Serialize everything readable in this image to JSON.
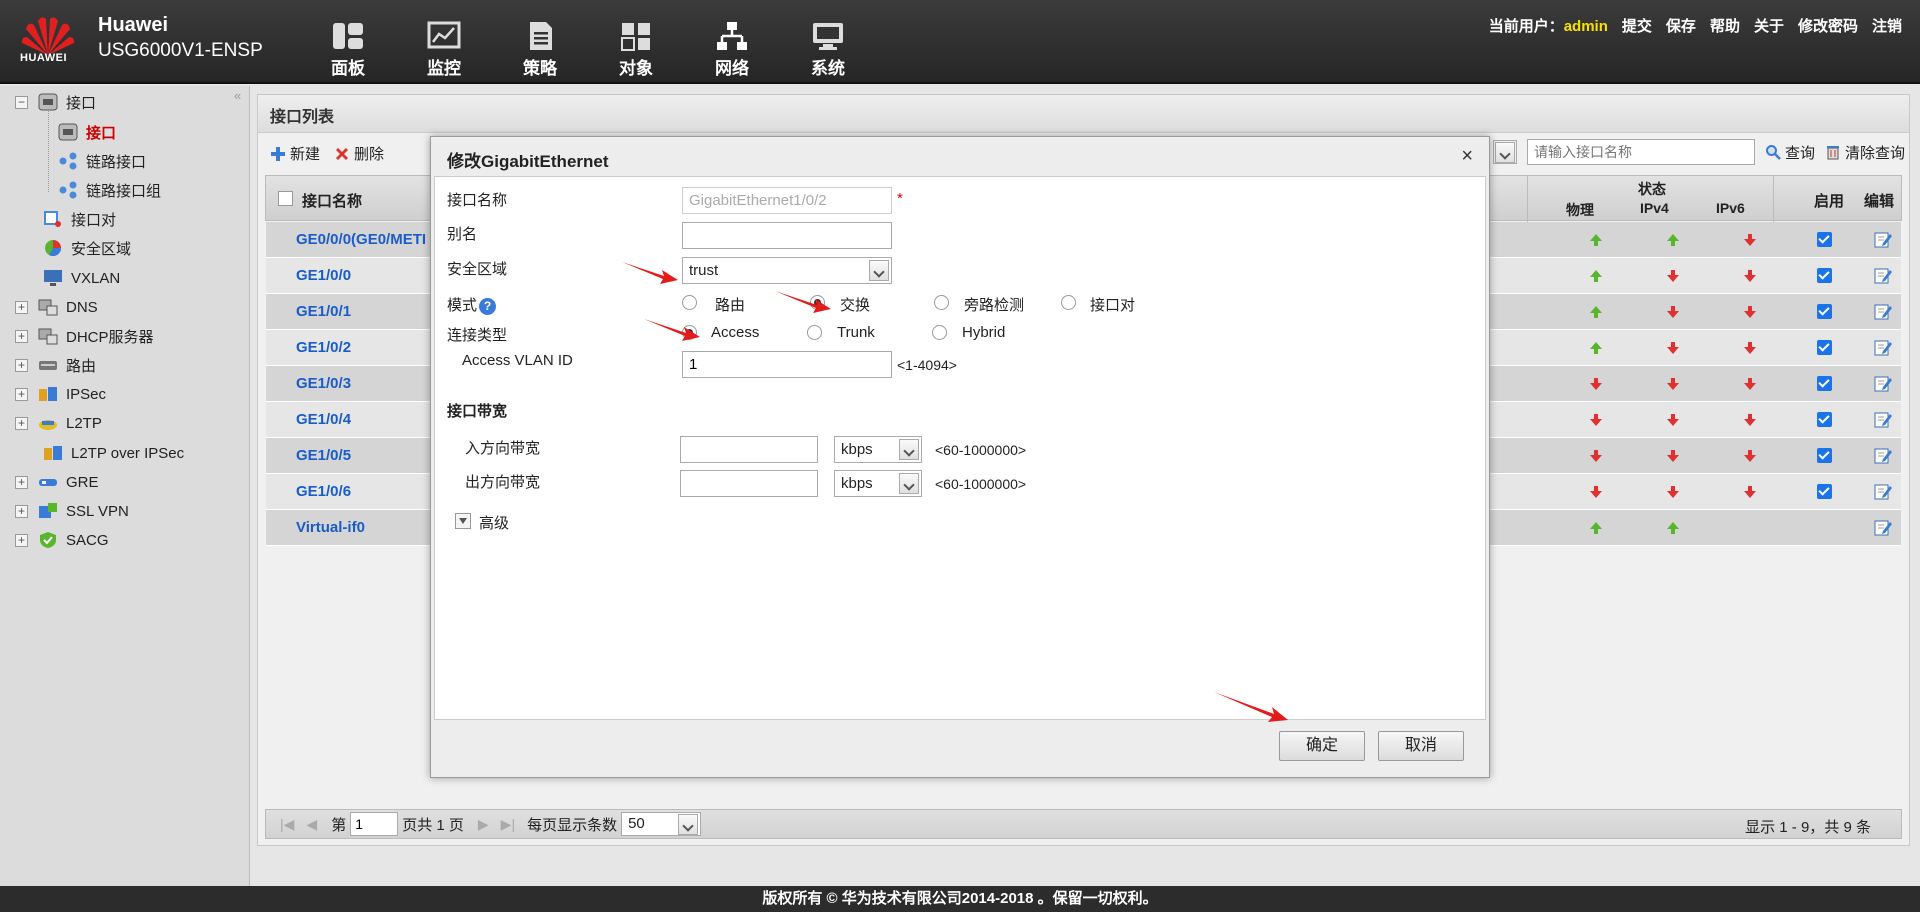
{
  "colors": {
    "accent_red": "#e02020",
    "link_blue": "#1b5cc8",
    "up_green": "#5ab52e",
    "down_red": "#e03030",
    "user_yellow": "#f8e000"
  },
  "header": {
    "logo_text": "HUAWEI",
    "brand": "Huawei",
    "model": "USG6000V1-ENSP",
    "nav": [
      {
        "label": "面板",
        "icon": "dashboard-icon"
      },
      {
        "label": "监控",
        "icon": "monitor-icon"
      },
      {
        "label": "策略",
        "icon": "policy-icon"
      },
      {
        "label": "对象",
        "icon": "object-icon"
      },
      {
        "label": "网络",
        "icon": "network-icon"
      },
      {
        "label": "系统",
        "icon": "system-icon"
      }
    ],
    "current_user_label": "当前用户：",
    "current_user": "admin",
    "links": [
      "提交",
      "保存",
      "帮助",
      "关于",
      "修改密码",
      "注销"
    ]
  },
  "sidebar": {
    "collapse_glyph": "«",
    "items": [
      {
        "label": "接口",
        "expander": "−"
      },
      {
        "label": "接口",
        "active": true
      },
      {
        "label": "链路接口"
      },
      {
        "label": "链路接口组"
      },
      {
        "label": "接口对"
      },
      {
        "label": "安全区域"
      },
      {
        "label": "VXLAN"
      },
      {
        "label": "DNS",
        "expander": "+"
      },
      {
        "label": "DHCP服务器",
        "expander": "+"
      },
      {
        "label": "路由",
        "expander": "+"
      },
      {
        "label": "IPSec",
        "expander": "+"
      },
      {
        "label": "L2TP",
        "expander": "+"
      },
      {
        "label": "L2TP over IPSec"
      },
      {
        "label": "GRE",
        "expander": "+"
      },
      {
        "label": "SSL VPN",
        "expander": "+"
      },
      {
        "label": "SACG",
        "expander": "+"
      }
    ]
  },
  "panel": {
    "title": "接口列表",
    "toolbar": {
      "new_label": "新建",
      "delete_label": "删除"
    },
    "search": {
      "placeholder": "请输入接口名称",
      "query_label": "查询",
      "clear_label": "清除查询"
    },
    "columns": {
      "name": "接口名称",
      "status": "状态",
      "physical": "物理",
      "ipv4": "IPv4",
      "ipv6": "IPv6",
      "enable": "启用",
      "edit": "编辑"
    },
    "rows": [
      {
        "name": "GE0/0/0(GE0/METI",
        "phy": "up",
        "v4": "up",
        "v6": "down",
        "enabled": true
      },
      {
        "name": "GE1/0/0",
        "phy": "up",
        "v4": "down",
        "v6": "down",
        "enabled": true
      },
      {
        "name": "GE1/0/1",
        "phy": "up",
        "v4": "down",
        "v6": "down",
        "enabled": true
      },
      {
        "name": "GE1/0/2",
        "phy": "up",
        "v4": "down",
        "v6": "down",
        "enabled": true
      },
      {
        "name": "GE1/0/3",
        "phy": "down",
        "v4": "down",
        "v6": "down",
        "enabled": true
      },
      {
        "name": "GE1/0/4",
        "phy": "down",
        "v4": "down",
        "v6": "down",
        "enabled": true
      },
      {
        "name": "GE1/0/5",
        "phy": "down",
        "v4": "down",
        "v6": "down",
        "enabled": true
      },
      {
        "name": "GE1/0/6",
        "phy": "down",
        "v4": "down",
        "v6": "down",
        "enabled": true
      },
      {
        "name": "Virtual-if0",
        "phy": "up",
        "v4": "up",
        "v6": "",
        "enabled": false
      }
    ],
    "pager": {
      "first": "|◀",
      "prev": "◀",
      "next": "▶",
      "last": "▶|",
      "page_label": "第",
      "page_value": "1",
      "page_total": "页共 1 页",
      "per_page_label": "每页显示条数",
      "per_page": "50",
      "summary": "显示 1 - 9，共 9 条"
    }
  },
  "modal": {
    "title": "修改GigabitEthernet",
    "close_glyph": "×",
    "required_mark": "*",
    "fields": {
      "name_label": "接口名称",
      "name_value": "GigabitEthernet1/0/2",
      "alias_label": "别名",
      "alias_value": "",
      "zone_label": "安全区域",
      "zone_value": "trust",
      "mode_label": "模式",
      "mode_help": "?",
      "mode_options": [
        "路由",
        "交换",
        "旁路检测",
        "接口对"
      ],
      "mode_selected": "交换",
      "conn_label": "连接类型",
      "conn_options": [
        "Access",
        "Trunk",
        "Hybrid"
      ],
      "conn_selected": "Access",
      "vlan_label": "Access VLAN ID",
      "vlan_value": "1",
      "vlan_hint": "<1-4094>",
      "bw_title": "接口带宽",
      "in_label": "入方向带宽",
      "out_label": "出方向带宽",
      "bw_unit": "kbps",
      "bw_hint": "<60-1000000>",
      "advanced_label": "高级"
    },
    "ok_label": "确定",
    "cancel_label": "取消"
  },
  "footer": {
    "copyright": "版权所有 © 华为技术有限公司2014-2018 。保留一切权利。"
  }
}
